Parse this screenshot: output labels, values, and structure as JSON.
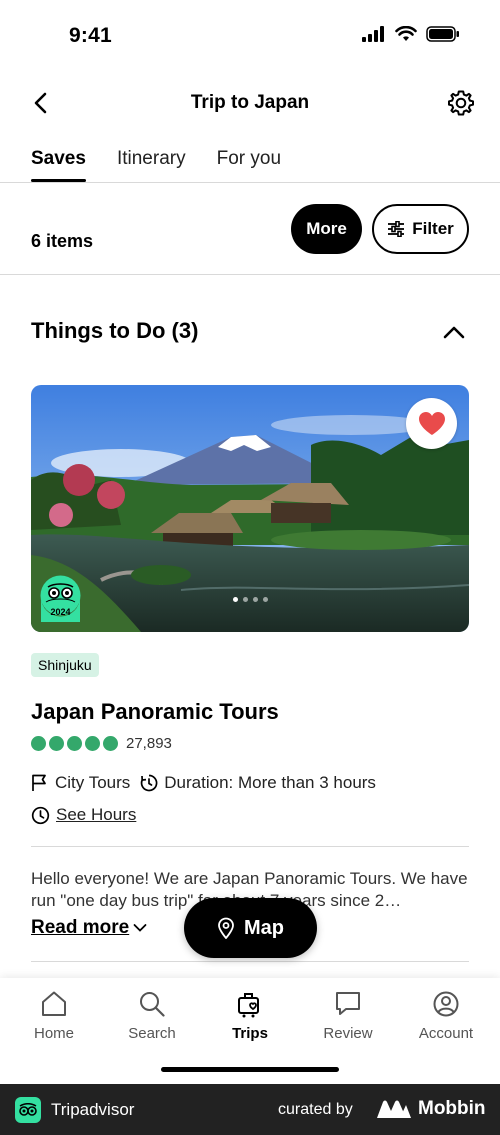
{
  "status_bar": {
    "time": "9:41"
  },
  "header": {
    "title": "Trip to Japan"
  },
  "tabs": [
    {
      "label": "Saves",
      "active": true
    },
    {
      "label": "Itinerary",
      "active": false
    },
    {
      "label": "For you",
      "active": false
    }
  ],
  "toolbar": {
    "items_count": "6 items",
    "more_label": "More",
    "filter_label": "Filter"
  },
  "section": {
    "title": "Things to Do (3)"
  },
  "listing": {
    "photo_index": 1,
    "photo_count": 4,
    "award_year": "2024",
    "location_tag": "Shinjuku",
    "name": "Japan Panoramic Tours",
    "rating_bubbles": 5,
    "review_count": "27,893",
    "category": "City Tours",
    "duration": "Duration: More than 3 hours",
    "see_hours": "See Hours",
    "description": "Hello everyone! We are Japan Panoramic Tours. We have run \"one day bus trip\" for about 7 years since 2…",
    "read_more": "Read more",
    "saved": true
  },
  "map_button": {
    "label": "Map"
  },
  "bottom_nav": [
    {
      "label": "Home",
      "icon": "home-icon",
      "active": false
    },
    {
      "label": "Search",
      "icon": "search-icon",
      "active": false
    },
    {
      "label": "Trips",
      "icon": "trips-icon",
      "active": true
    },
    {
      "label": "Review",
      "icon": "review-icon",
      "active": false
    },
    {
      "label": "Account",
      "icon": "account-icon",
      "active": false
    }
  ],
  "footer": {
    "brand": "Tripadvisor",
    "curated_by": "curated by",
    "partner": "Mobbin"
  },
  "colors": {
    "accent_green": "#34a86b",
    "tag_bg": "#d6f2e5",
    "heart_red": "#e94b4b",
    "footer_bg": "#222222"
  }
}
